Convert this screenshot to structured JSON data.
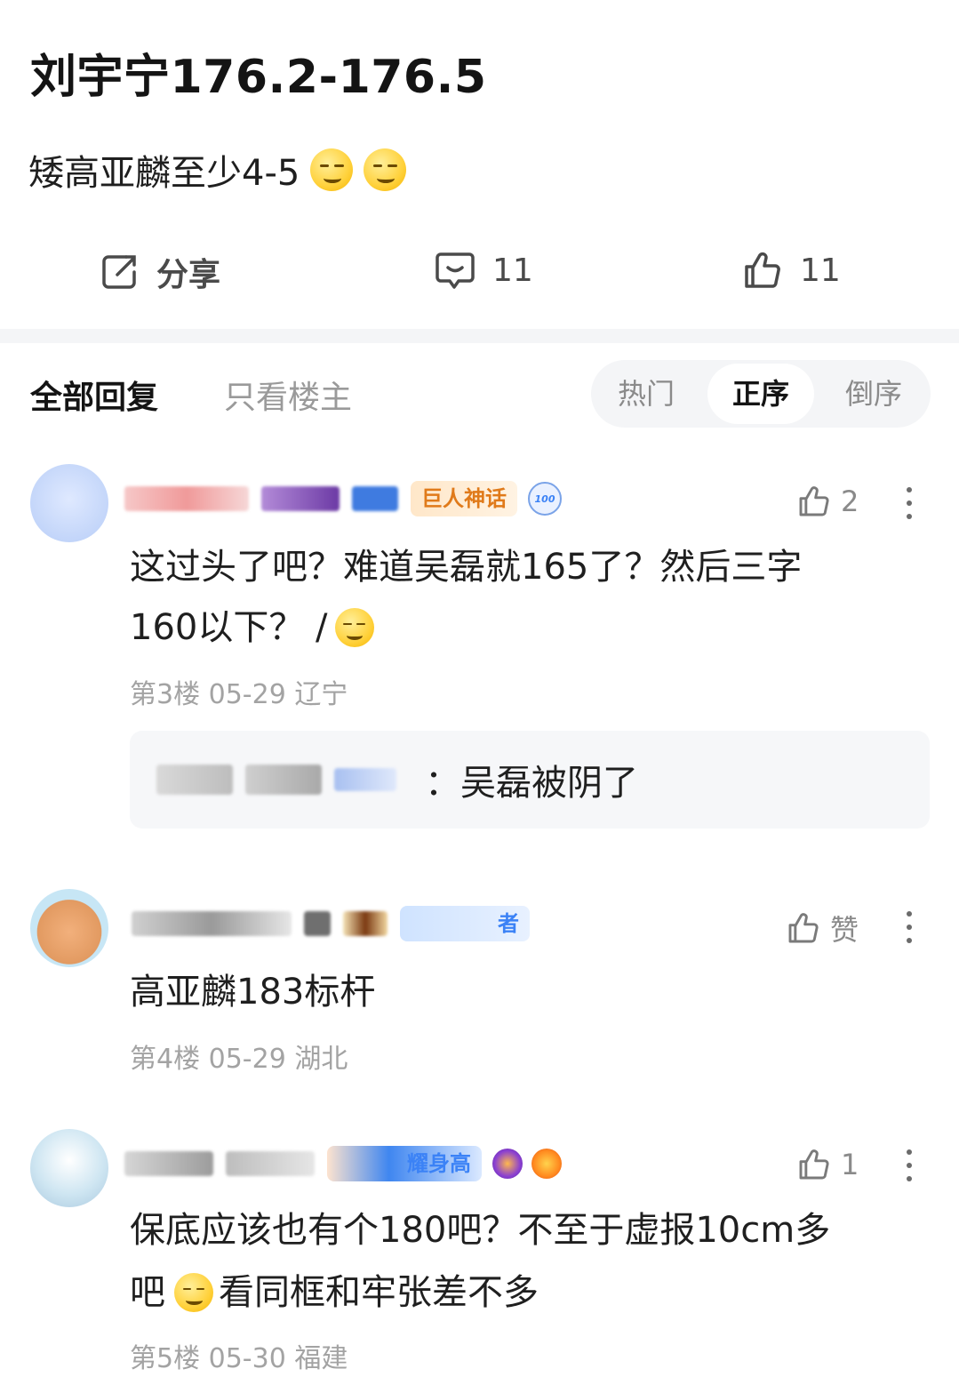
{
  "post": {
    "title": "刘宇宁176.2-176.5",
    "body": "矮高亚麟至少4-5"
  },
  "actions": {
    "share_label": "分享",
    "comment_count": "11",
    "like_count": "11"
  },
  "tabs": {
    "all_replies": "全部回复",
    "op_only": "只看楼主",
    "sort": {
      "hot": "热门",
      "ascending": "正序",
      "descending": "倒序",
      "selected": "正序"
    }
  },
  "comments": [
    {
      "badge": "巨人神话",
      "badge_number": "100",
      "text_line1": "这过头了吧？难道吴磊就165了？然后三字",
      "text_line2": "160以下？ /",
      "meta": "第3楼 05-29 辽宁",
      "likes": "2",
      "reply": {
        "text": "：吴磊被阴了"
      }
    },
    {
      "badge": "者",
      "text_line1": "高亚麟183标杆",
      "meta": "第4楼 05-29 湖北",
      "likes": "赞"
    },
    {
      "badge": "耀身高",
      "text_line1": "保底应该也有个180吧？不至于虚报10cm多",
      "text_line2_a": "吧",
      "text_line2_b": "看同框和牢张差不多",
      "meta": "第5楼 05-30 福建",
      "likes": "1"
    }
  ],
  "colors": {
    "primary_text": "#1f1f1f",
    "secondary_text": "#a3a3a3",
    "divider": "#f4f5f7",
    "badge_orange": "#e07a1a",
    "badge_blue": "#3b82f6"
  }
}
